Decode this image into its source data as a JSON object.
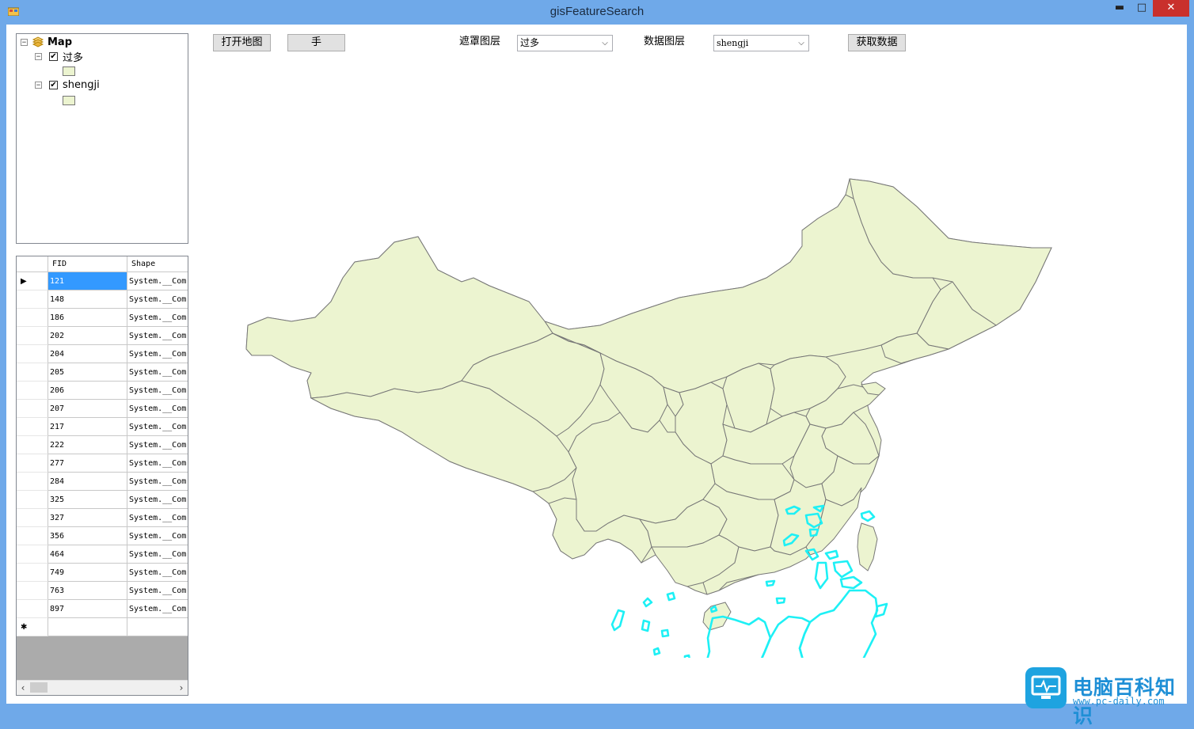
{
  "window": {
    "title": "gisFeatureSearch",
    "min_glyph": "▬",
    "max_glyph": "□",
    "close_glyph": "✕"
  },
  "toc": {
    "root_label": "Map",
    "layers": [
      {
        "label": "过多",
        "checked": true,
        "swatch_color": "#ecf4d0"
      },
      {
        "label": "shengji",
        "checked": true,
        "swatch_color": "#ecf4d0"
      }
    ],
    "collapse_glyph": "−",
    "check_glyph": "✔"
  },
  "grid": {
    "columns": [
      "FID",
      "Shape"
    ],
    "rows": [
      {
        "fid": "121",
        "shape": "System.__Com",
        "selected": true
      },
      {
        "fid": "148",
        "shape": "System.__Com"
      },
      {
        "fid": "186",
        "shape": "System.__Com"
      },
      {
        "fid": "202",
        "shape": "System.__Com"
      },
      {
        "fid": "204",
        "shape": "System.__Com"
      },
      {
        "fid": "205",
        "shape": "System.__Com"
      },
      {
        "fid": "206",
        "shape": "System.__Com"
      },
      {
        "fid": "207",
        "shape": "System.__Com"
      },
      {
        "fid": "217",
        "shape": "System.__Com"
      },
      {
        "fid": "222",
        "shape": "System.__Com"
      },
      {
        "fid": "277",
        "shape": "System.__Com"
      },
      {
        "fid": "284",
        "shape": "System.__Com"
      },
      {
        "fid": "325",
        "shape": "System.__Com"
      },
      {
        "fid": "327",
        "shape": "System.__Com"
      },
      {
        "fid": "356",
        "shape": "System.__Com"
      },
      {
        "fid": "464",
        "shape": "System.__Com"
      },
      {
        "fid": "749",
        "shape": "System.__Com"
      },
      {
        "fid": "763",
        "shape": "System.__Com"
      },
      {
        "fid": "897",
        "shape": "System.__Com"
      }
    ],
    "current_row_glyph": "▶",
    "new_row_glyph": "✱",
    "scroll_left": "‹",
    "scroll_right": "›"
  },
  "toolbar": {
    "open_map": "打开地图",
    "hand": "手",
    "mask_layer_label": "遮罩图层",
    "mask_layer_value": "过多",
    "data_layer_label": "数据图层",
    "data_layer_value": "shengji",
    "get_data": "获取数据",
    "dropdown_glyph": "⌵"
  },
  "map": {
    "fill_color": "#ecf4d0",
    "stroke_color": "#777777",
    "highlight_color": "#1ef0f5"
  },
  "watermark": {
    "text": "电脑百科知识",
    "url": "www.pc-daily.com"
  }
}
